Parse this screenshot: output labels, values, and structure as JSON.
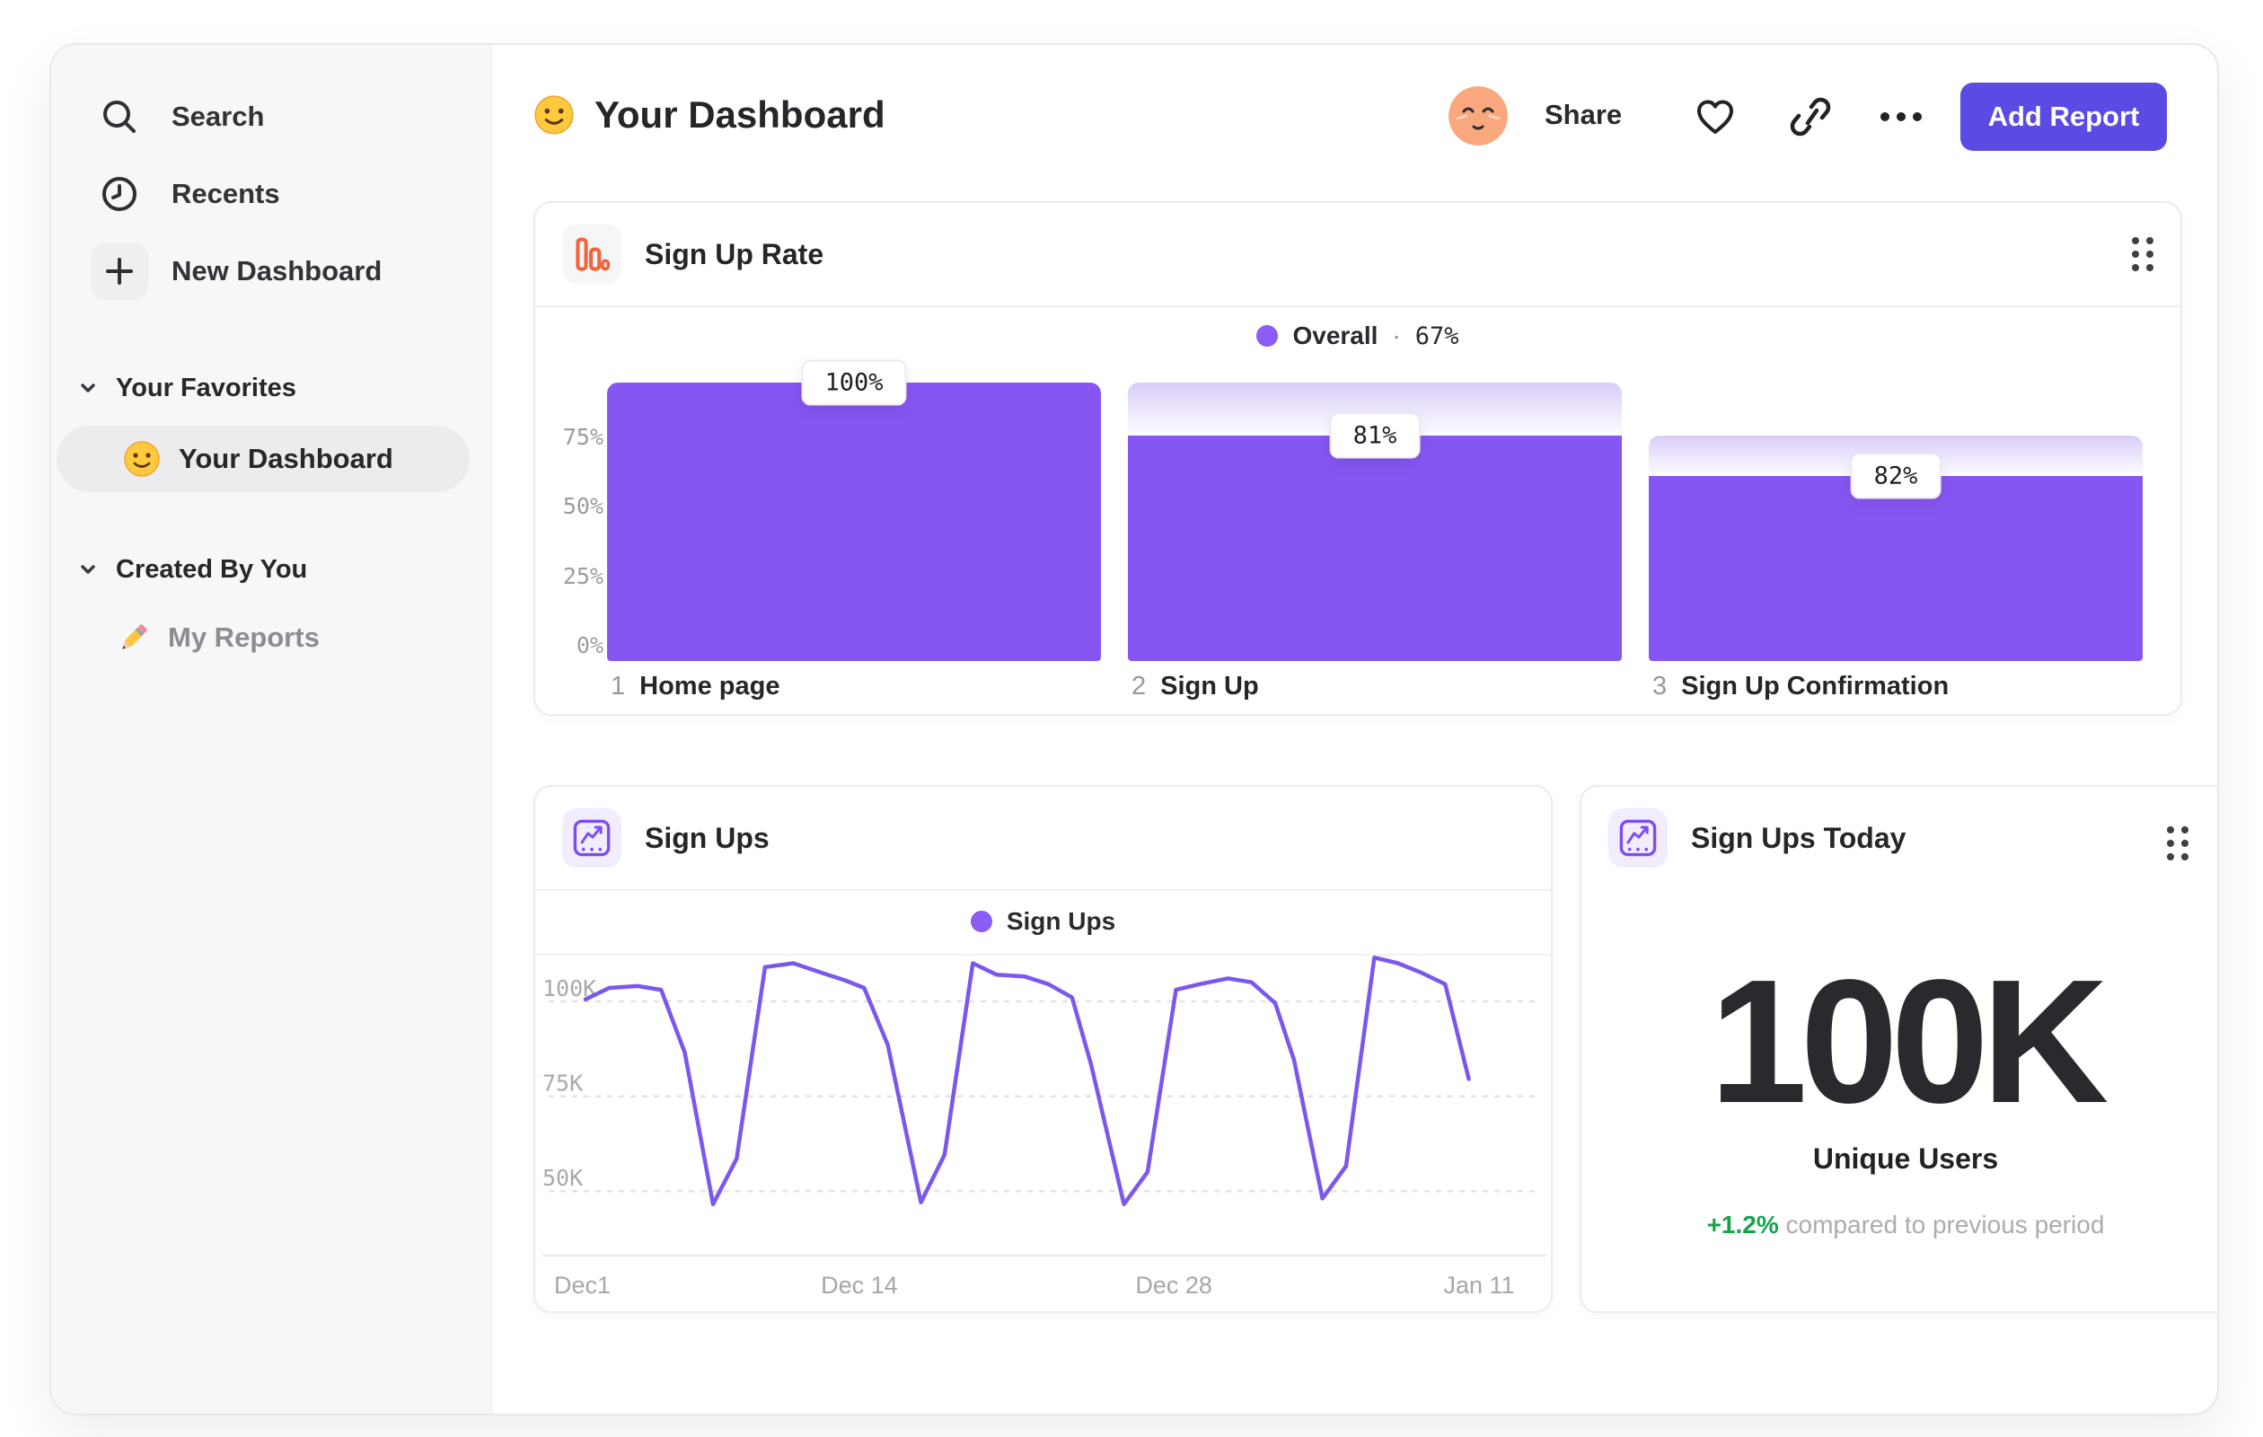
{
  "sidebar": {
    "nav_items": [
      {
        "label": "Search"
      },
      {
        "label": "Recents"
      },
      {
        "label": "New Dashboard"
      }
    ],
    "sections": [
      {
        "title": "Your Favorites",
        "items": [
          {
            "label": "Your Dashboard",
            "selected": true
          }
        ]
      },
      {
        "title": "Created By You",
        "items": [
          {
            "label": "My Reports",
            "selected": false
          }
        ]
      }
    ]
  },
  "header": {
    "title": "Your Dashboard",
    "actions": {
      "share": "Share",
      "add_report": "Add Report"
    }
  },
  "funnel_card": {
    "title": "Sign Up Rate",
    "legend_label": "Overall",
    "legend_separator": "·",
    "legend_value": "67%"
  },
  "line_card": {
    "title": "Sign Ups",
    "legend_label": "Sign Ups"
  },
  "today_card": {
    "title": "Sign Ups Today",
    "value": "100K",
    "subtitle": "Unique Users",
    "delta": "+1.2%",
    "delta_note": "compared to previous period"
  },
  "colors": {
    "bar_purple": "#8656F2",
    "legend_dot_purple": "#8B5CF6",
    "line_purple": "#7B57EE",
    "button_purple": "#5B4BE4",
    "positive_green": "#16A34A",
    "funnel_icon_orange": "#F0653E"
  },
  "chart_data": [
    {
      "type": "bar",
      "subtype": "funnel",
      "title": "Sign Up Rate",
      "legend": "Overall · 67%",
      "overall_pct": 67,
      "categories": [
        "1 Home page",
        "2 Sign Up",
        "3 Sign Up Confirmation"
      ],
      "steps": [
        {
          "index": "1",
          "label": "Home page",
          "display_pct": "100%",
          "pct_of_previous": 100
        },
        {
          "index": "2",
          "label": "Sign Up",
          "display_pct": "81%",
          "pct_of_previous": 81
        },
        {
          "index": "3",
          "label": "Sign Up Confirmation",
          "display_pct": "82%",
          "pct_of_previous": 82
        }
      ],
      "yticks": [
        {
          "label": "75%",
          "value": 75
        },
        {
          "label": "50%",
          "value": 50
        },
        {
          "label": "25%",
          "value": 25
        },
        {
          "label": "0%",
          "value": 0
        }
      ],
      "ylim": [
        0,
        100
      ],
      "grid": false,
      "legend_position": "top-center"
    },
    {
      "type": "line",
      "title": "Sign Ups",
      "series": [
        {
          "name": "Sign Ups",
          "points": [
            [
              0,
              97
            ],
            [
              2.5,
              100
            ],
            [
              5.5,
              100.5
            ],
            [
              8,
              99.5
            ],
            [
              10.5,
              83
            ],
            [
              13.5,
              43
            ],
            [
              16,
              55
            ],
            [
              19,
              105.5
            ],
            [
              22,
              106.5
            ],
            [
              25,
              104
            ],
            [
              27.5,
              102
            ],
            [
              29.5,
              100
            ],
            [
              32,
              85
            ],
            [
              35.5,
              43.5
            ],
            [
              38,
              56
            ],
            [
              41,
              106.5
            ],
            [
              43.5,
              103.5
            ],
            [
              46.5,
              103
            ],
            [
              49,
              101
            ],
            [
              51.5,
              97.5
            ],
            [
              53.5,
              80
            ],
            [
              57,
              43
            ],
            [
              59.5,
              51.5
            ],
            [
              62.5,
              99.5
            ],
            [
              65,
              101
            ],
            [
              68,
              102.5
            ],
            [
              70.5,
              101.5
            ],
            [
              73,
              96
            ],
            [
              75,
              81
            ],
            [
              78,
              44.5
            ],
            [
              80.5,
              53
            ],
            [
              83.5,
              108
            ],
            [
              86,
              106.5
            ],
            [
              88.5,
              104
            ],
            [
              91,
              101
            ],
            [
              93.5,
              76
            ]
          ]
        }
      ],
      "unit": "K",
      "yticks": [
        {
          "label": "100K",
          "value": 100
        },
        {
          "label": "75K",
          "value": 75
        },
        {
          "label": "50K",
          "value": 50
        }
      ],
      "xticks": [
        {
          "label": "Dec1",
          "pos": 0
        },
        {
          "label": "Dec 14",
          "pos": 33
        },
        {
          "label": "Dec 28",
          "pos": 67
        },
        {
          "label": "Jan 11",
          "pos": 100
        }
      ],
      "ylim": [
        38000,
        112000
      ],
      "grid": "dashed-horizontal",
      "legend_position": "top-center"
    }
  ]
}
